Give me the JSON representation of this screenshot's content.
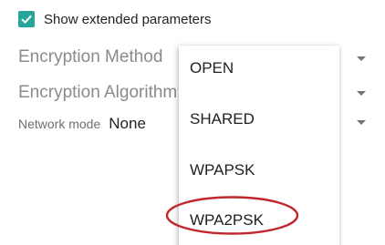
{
  "checkbox": {
    "label": "Show extended parameters",
    "checked": true,
    "color": "#26a69a"
  },
  "fields": {
    "encryption_method_label": "Encryption Method",
    "encryption_algorithm_label": "Encryption Algorithm",
    "network_mode_label": "Network mode",
    "network_mode_value": "None"
  },
  "dropdown": {
    "options": [
      "OPEN",
      "SHARED",
      "WPAPSK",
      "WPA2PSK"
    ],
    "highlighted_option": "WPA2PSK",
    "highlight_color": "#c0282d"
  },
  "icons": {
    "check": "check-icon",
    "arrow": "dropdown-arrow-icon"
  }
}
